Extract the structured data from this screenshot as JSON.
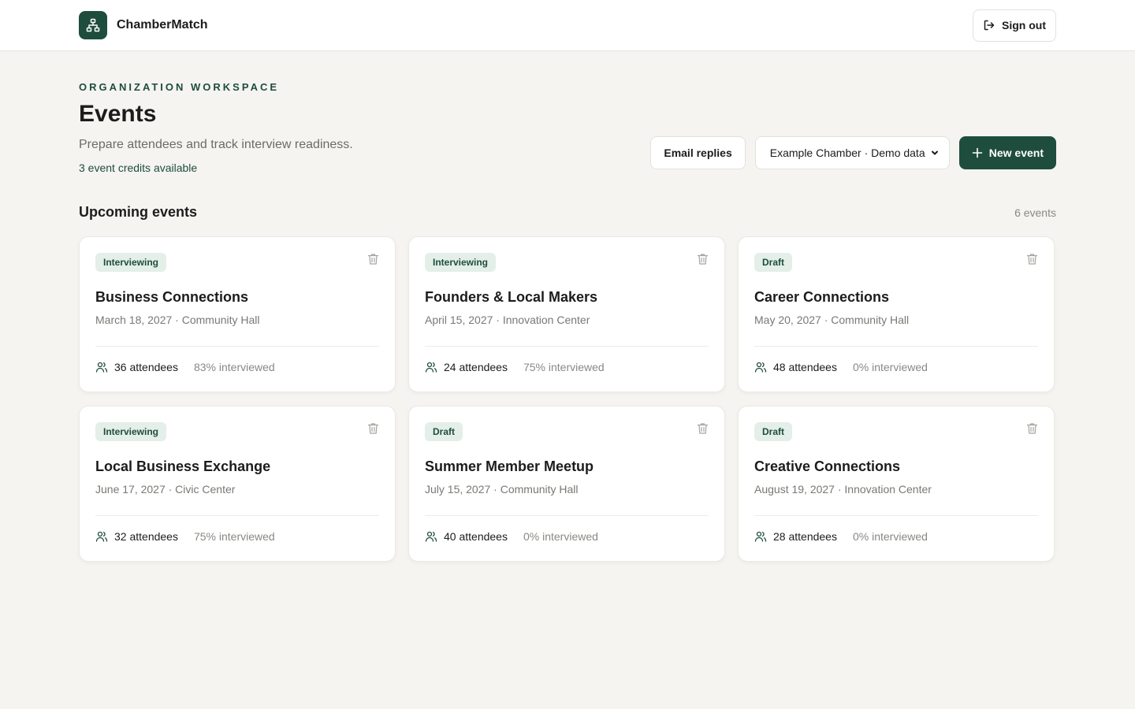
{
  "app": {
    "name": "ChamberMatch",
    "sign_out_label": "Sign out"
  },
  "header": {
    "eyebrow": "ORGANIZATION WORKSPACE",
    "title": "Events",
    "subtitle": "Prepare attendees and track interview readiness.",
    "credits": "3 event credits available"
  },
  "actions": {
    "email_replies_label": "Email replies",
    "org_select_value": "Example Chamber · Demo data",
    "new_event_label": "New event"
  },
  "section": {
    "title": "Upcoming events",
    "count": "6 events"
  },
  "events": [
    {
      "status": "Interviewing",
      "title": "Business Connections",
      "meta": "March 18, 2027 · Community Hall",
      "attendees": "36 attendees",
      "interviewed": "83% interviewed"
    },
    {
      "status": "Interviewing",
      "title": "Founders & Local Makers",
      "meta": "April 15, 2027 · Innovation Center",
      "attendees": "24 attendees",
      "interviewed": "75% interviewed"
    },
    {
      "status": "Draft",
      "title": "Career Connections",
      "meta": "May 20, 2027 · Community Hall",
      "attendees": "48 attendees",
      "interviewed": "0% interviewed"
    },
    {
      "status": "Interviewing",
      "title": "Local Business Exchange",
      "meta": "June 17, 2027 · Civic Center",
      "attendees": "32 attendees",
      "interviewed": "75% interviewed"
    },
    {
      "status": "Draft",
      "title": "Summer Member Meetup",
      "meta": "July 15, 2027 · Community Hall",
      "attendees": "40 attendees",
      "interviewed": "0% interviewed"
    },
    {
      "status": "Draft",
      "title": "Creative Connections",
      "meta": "August 19, 2027 · Innovation Center",
      "attendees": "28 attendees",
      "interviewed": "0% interviewed"
    }
  ],
  "colors": {
    "brand": "#1e4d3e",
    "background": "#f5f4f0",
    "badge_bg": "#e3efe8"
  }
}
